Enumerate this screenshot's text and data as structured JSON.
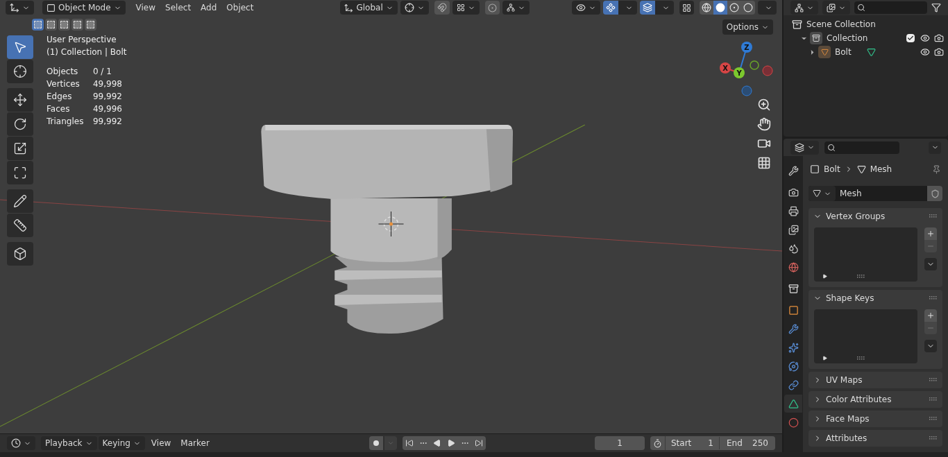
{
  "viewport": {
    "header": {
      "mode": "Object Mode",
      "menus": [
        "View",
        "Select",
        "Add",
        "Object"
      ],
      "orientation": "Global",
      "options": "Options",
      "select_modes": [
        {
          "selected": true
        },
        {
          "selected": false
        },
        {
          "selected": false
        },
        {
          "selected": false
        },
        {
          "selected": false
        }
      ],
      "shading_modes": [
        {
          "kind": "wireframe",
          "selected": false
        },
        {
          "kind": "solid",
          "selected": true
        },
        {
          "kind": "material",
          "selected": false
        },
        {
          "kind": "rendered",
          "selected": false
        }
      ]
    },
    "tools": [
      {
        "kind": "select",
        "selected": true
      },
      {
        "kind": "cursor",
        "selected": false
      },
      {
        "kind": "move",
        "selected": false
      },
      {
        "kind": "rotate",
        "selected": false
      },
      {
        "kind": "scale",
        "selected": false
      },
      {
        "kind": "transform",
        "selected": false
      },
      {
        "kind": "annotate",
        "selected": false
      },
      {
        "kind": "measure",
        "selected": false
      },
      {
        "kind": "add-cube",
        "selected": false
      }
    ],
    "view_name": "User Perspective",
    "collection_line": "(1) Collection | Bolt",
    "stats": [
      {
        "label": "Objects",
        "value": "0 / 1"
      },
      {
        "label": "Vertices",
        "value": "49,998"
      },
      {
        "label": "Edges",
        "value": "99,992"
      },
      {
        "label": "Faces",
        "value": "49,996"
      },
      {
        "label": "Triangles",
        "value": "99,992"
      }
    ],
    "gizmo": {
      "z": "Z",
      "x": "X",
      "y": "Y"
    }
  },
  "outliner": {
    "items": [
      {
        "label": "Scene Collection",
        "kind": "scene",
        "children": [
          {
            "label": "Collection",
            "kind": "collection",
            "expanded": true,
            "checked": true,
            "children": [
              {
                "label": "Bolt",
                "kind": "object",
                "expanded": false
              }
            ]
          }
        ]
      }
    ]
  },
  "properties": {
    "tabs": [
      {
        "kind": "tool",
        "selected": false
      },
      {
        "kind": "render",
        "selected": false
      },
      {
        "kind": "output",
        "selected": false
      },
      {
        "kind": "view-layer",
        "selected": false
      },
      {
        "kind": "scene",
        "selected": false
      },
      {
        "kind": "world",
        "selected": false
      },
      {
        "kind": "collection",
        "selected": false
      },
      {
        "kind": "object",
        "selected": false
      },
      {
        "kind": "modifiers",
        "selected": false
      },
      {
        "kind": "particles",
        "selected": false
      },
      {
        "kind": "physics",
        "selected": false
      },
      {
        "kind": "constraints",
        "selected": false
      },
      {
        "kind": "data",
        "selected": true
      },
      {
        "kind": "material",
        "selected": false
      }
    ],
    "breadcrumb": [
      "Bolt",
      "Mesh"
    ],
    "datablock": "Mesh",
    "panels": [
      {
        "title": "Vertex Groups",
        "expanded": true
      },
      {
        "title": "Shape Keys",
        "expanded": true
      },
      {
        "title": "UV Maps",
        "expanded": false
      },
      {
        "title": "Color Attributes",
        "expanded": false
      },
      {
        "title": "Face Maps",
        "expanded": false
      },
      {
        "title": "Attributes",
        "expanded": false
      }
    ]
  },
  "timeline": {
    "menus": [
      {
        "label": "Playback",
        "dropdown": true
      },
      {
        "label": "Keying",
        "dropdown": true
      },
      {
        "label": "View",
        "dropdown": false
      },
      {
        "label": "Marker",
        "dropdown": false
      }
    ],
    "current_frame": "1",
    "start_label": "Start",
    "start": "1",
    "end_label": "End",
    "end": "250"
  }
}
